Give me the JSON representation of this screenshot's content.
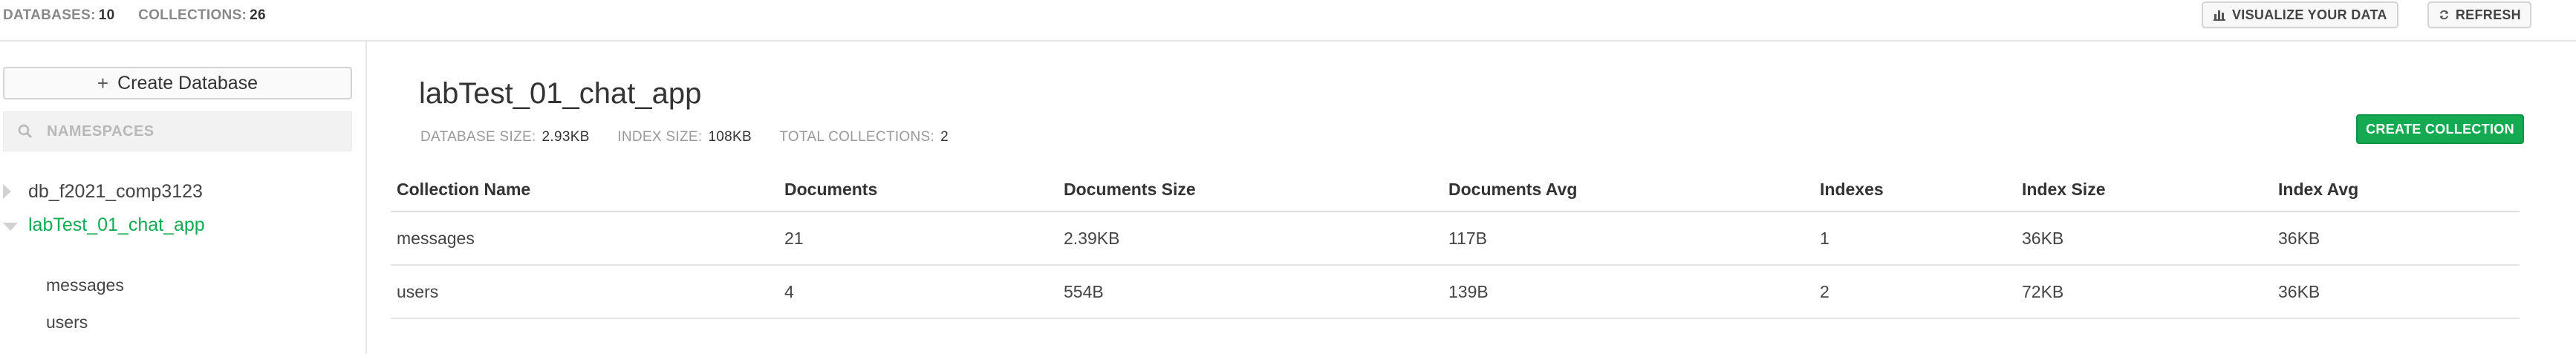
{
  "header": {
    "databases_label": "DATABASES:",
    "databases_count": "10",
    "collections_label": "COLLECTIONS:",
    "collections_count": "26",
    "visualize_label": "VISUALIZE YOUR DATA",
    "refresh_label": "REFRESH"
  },
  "sidebar": {
    "create_database_label": "Create Database",
    "namespace_placeholder": "NAMESPACES",
    "databases": [
      {
        "name": "db_f2021_comp3123",
        "expanded": false
      },
      {
        "name": "labTest_01_chat_app",
        "expanded": true,
        "collections": [
          "messages",
          "users"
        ]
      }
    ]
  },
  "main": {
    "title": "labTest_01_chat_app",
    "meta": {
      "db_size_label": "DATABASE SIZE:",
      "db_size": "2.93KB",
      "index_size_label": "INDEX SIZE:",
      "index_size": "108KB",
      "total_collections_label": "TOTAL COLLECTIONS:",
      "total_collections": "2"
    },
    "create_collection_label": "CREATE COLLECTION",
    "table": {
      "columns": [
        "Collection Name",
        "Documents",
        "Documents Size",
        "Documents Avg",
        "Indexes",
        "Index Size",
        "Index Avg"
      ],
      "rows": [
        [
          "messages",
          "21",
          "2.39KB",
          "117B",
          "1",
          "36KB",
          "36KB"
        ],
        [
          "users",
          "4",
          "554B",
          "139B",
          "2",
          "72KB",
          "36KB"
        ]
      ]
    }
  },
  "colors": {
    "accent_green": "#13aa52",
    "link_blue": "#1a79c2"
  }
}
